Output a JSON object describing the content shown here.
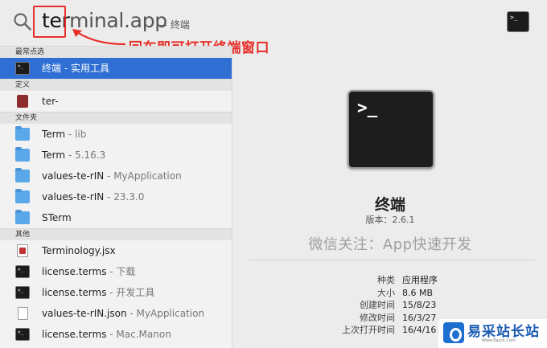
{
  "search": {
    "typed": "ter",
    "completion": "minal.app",
    "hint": "— 终端"
  },
  "annotation": {
    "text": "回车即可打开终端窗口",
    "color": "#e8302a"
  },
  "colors": {
    "selection": "#2f6fd4",
    "folder": "#5aa8ea",
    "watermark": "#a0a0a0"
  },
  "sections": [
    {
      "header": "最常点选",
      "items": [
        {
          "label": "终端",
          "sub": " - 实用工具",
          "icon": "terminal-app-icon",
          "selected": true
        }
      ]
    },
    {
      "header": "定义",
      "items": [
        {
          "label": "ter-",
          "sub": "",
          "icon": "dictionary-icon",
          "selected": false
        }
      ]
    },
    {
      "header": "文件夹",
      "items": [
        {
          "label": "Term",
          "sub": " - lib",
          "icon": "folder-icon",
          "selected": false
        },
        {
          "label": "Term",
          "sub": " - 5.16.3",
          "icon": "folder-icon",
          "selected": false
        },
        {
          "label": "values-te-rIN",
          "sub": " - MyApplication",
          "icon": "folder-icon",
          "selected": false
        },
        {
          "label": "values-te-rIN",
          "sub": " - 23.3.0",
          "icon": "folder-icon",
          "selected": false
        },
        {
          "label": "STerm",
          "sub": "",
          "icon": "folder-icon",
          "selected": false
        }
      ]
    },
    {
      "header": "其他",
      "items": [
        {
          "label": "Terminology.jsx",
          "sub": "",
          "icon": "jsx-file-icon",
          "selected": false
        },
        {
          "label": "license.terms",
          "sub": " - 下载",
          "icon": "terminal-doc-icon",
          "selected": false
        },
        {
          "label": "license.terms",
          "sub": " - 开发工具",
          "icon": "terminal-doc-icon",
          "selected": false
        },
        {
          "label": "values-te-rIN.json",
          "sub": " - MyApplication",
          "icon": "document-icon",
          "selected": false
        },
        {
          "label": "license.terms",
          "sub": " - Mac.Manon",
          "icon": "terminal-doc-icon",
          "selected": false
        }
      ]
    }
  ],
  "preview": {
    "prompt_glyph": ">_",
    "name": "终端",
    "version": "版本：2.6.1",
    "watermark": "微信关注：App快速开发",
    "meta": [
      {
        "key": "种类",
        "value": "应用程序"
      },
      {
        "key": "大小",
        "value": "8.6 MB"
      },
      {
        "key": "创建时间",
        "value": "15/8/23"
      },
      {
        "key": "修改时间",
        "value": "16/3/27"
      },
      {
        "key": "上次打开时间",
        "value": "16/4/16"
      }
    ]
  },
  "site_logo": {
    "name": "易采站长站",
    "url": "Www.Easck.Com"
  }
}
